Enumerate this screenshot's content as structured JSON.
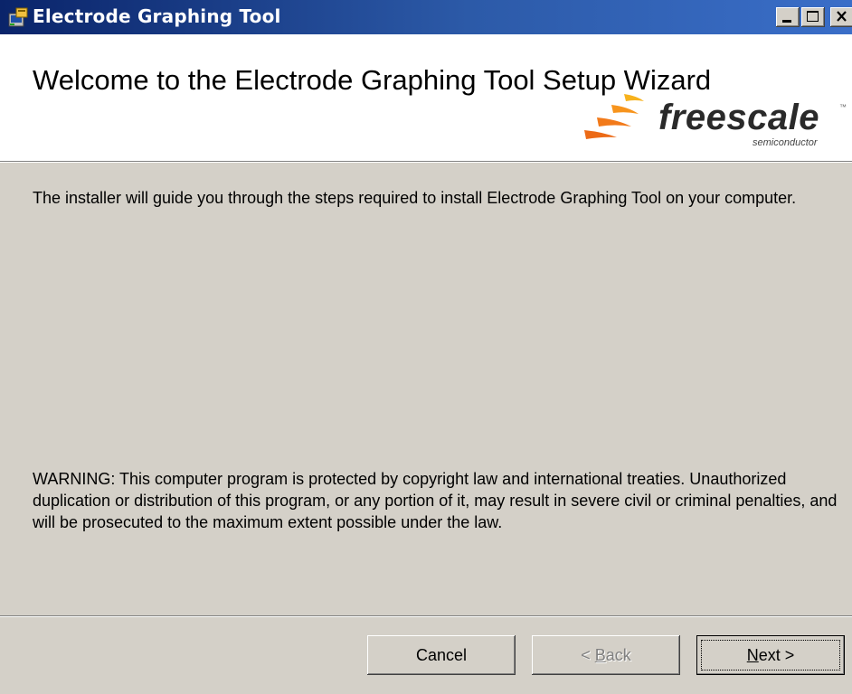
{
  "window": {
    "title": "Electrode Graphing Tool",
    "icon": "installer-icon",
    "controls": [
      "minimize-icon",
      "maximize-icon",
      "close-icon"
    ]
  },
  "header": {
    "title": "Welcome to the Electrode Graphing Tool Setup Wizard",
    "logo": {
      "word": "freescale",
      "subtitle": "semiconductor",
      "tm": "™"
    }
  },
  "body": {
    "intro": "The installer will guide you through the steps required to install Electrode Graphing Tool on your computer.",
    "warning": "WARNING: This computer program is protected by copyright law and international treaties. Unauthorized duplication or distribution of this program, or any portion of it, may result in severe civil or criminal penalties, and will be prosecuted to the maximum extent possible under the law."
  },
  "buttons": {
    "cancel": "Cancel",
    "back_prefix": "< ",
    "back_mnemonic": "B",
    "back_rest": "ack",
    "next_mnemonic": "N",
    "next_rest": "ext >"
  },
  "colors": {
    "titlebar_start": "#0a246a",
    "titlebar_end": "#3a6ec8",
    "dialog_bg": "#d4d0c8",
    "header_bg": "#ffffff",
    "logo_orange": "#f7941d"
  }
}
